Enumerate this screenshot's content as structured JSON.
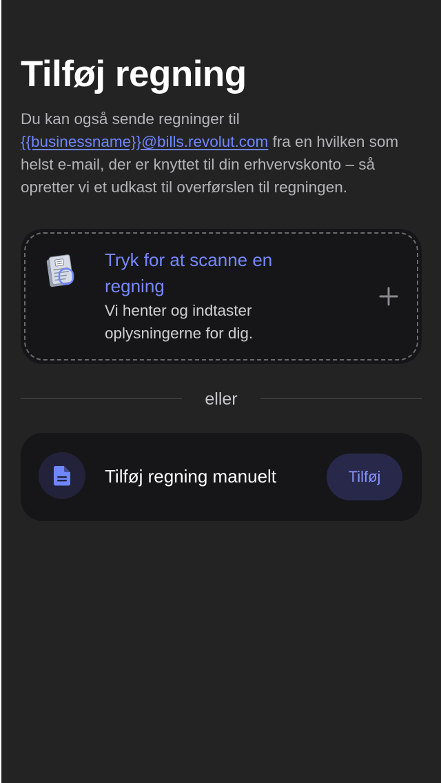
{
  "page": {
    "title": "Tilføj regning",
    "description": {
      "text_before": "Du kan også sende regninger til ",
      "email_link": "{{businessname}}@bills.revolut.com",
      "text_after": " fra en hvilken som helst e-mail, der er knyttet til din erhvervskonto – så opretter vi et udkast til overførslen til regningen."
    }
  },
  "scan_card": {
    "title": "Tryk for at scanne en regning",
    "subtitle": "Vi henter og indtaster oplysningerne for dig.",
    "icon": "receipt-scan-icon",
    "action_icon": "plus-icon"
  },
  "divider": {
    "label": "eller"
  },
  "manual_card": {
    "icon": "document-icon",
    "label": "Tilføj regning manuelt",
    "button_label": "Tilføj"
  },
  "colors": {
    "background": "#232324",
    "card": "#161618",
    "accent": "#7688ff",
    "button_bg": "#27284a"
  }
}
